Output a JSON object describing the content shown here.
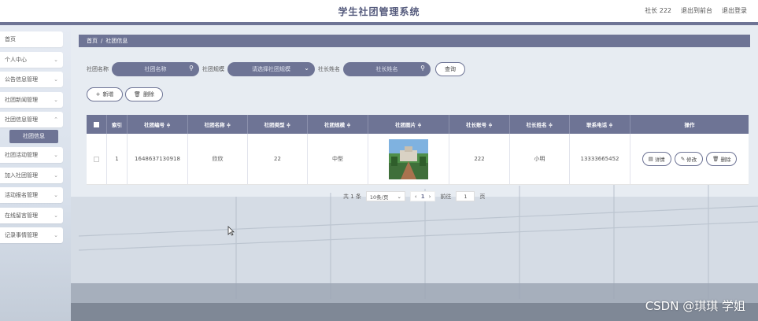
{
  "header": {
    "title": "学生社团管理系统",
    "user_label": "社长 222",
    "go_front": "退出到前台",
    "logout": "退出登录"
  },
  "sidebar": {
    "items": [
      {
        "label": "首页",
        "has_chevron": false
      },
      {
        "label": "个人中心",
        "has_chevron": true
      },
      {
        "label": "公告信息管理",
        "has_chevron": true
      },
      {
        "label": "社团新闻管理",
        "has_chevron": true
      },
      {
        "label": "社团信息管理",
        "has_chevron": true,
        "expanded": true
      },
      {
        "label": "社团活动管理",
        "has_chevron": true
      },
      {
        "label": "加入社团管理",
        "has_chevron": true
      },
      {
        "label": "活动报名管理",
        "has_chevron": true
      },
      {
        "label": "在线留言管理",
        "has_chevron": true
      },
      {
        "label": "记录事情管理",
        "has_chevron": true
      }
    ],
    "active_subitem": "社团信息"
  },
  "breadcrumb": {
    "home": "首页",
    "sep": "/",
    "current": "社团信息"
  },
  "search": {
    "name_label": "社团名称",
    "name_placeholder": "社团名称",
    "scale_label": "社团规模",
    "scale_placeholder": "请选择社团规模",
    "leader_label": "社长姓名",
    "leader_placeholder": "社长姓名",
    "query_button": "查询"
  },
  "actions": {
    "add": "新增",
    "delete": "删除"
  },
  "table": {
    "headers": [
      "索引",
      "社团编号 ≑",
      "社团名称 ≑",
      "社团类型 ≑",
      "社团规模 ≑",
      "社团图片 ≑",
      "社长账号 ≑",
      "社长姓名 ≑",
      "联系电话 ≑",
      "操作"
    ],
    "rows": [
      {
        "index": "1",
        "club_no": "1648637130918",
        "club_name": "欣欣",
        "club_type": "22",
        "club_scale": "中型",
        "leader_account": "222",
        "leader_name": "小明",
        "phone": "13333665452",
        "ops": {
          "detail": "详情",
          "edit": "修改",
          "delete": "删除"
        }
      }
    ]
  },
  "pagination": {
    "total": "共 1 条",
    "page_size": "10条/页",
    "current_page": "1",
    "goto_label": "前往",
    "goto_value": "1",
    "page_unit": "页"
  },
  "watermark": "CSDN @琪琪 学姐",
  "colors": {
    "accent": "#6e7495",
    "header_bg": "#ffffff"
  }
}
